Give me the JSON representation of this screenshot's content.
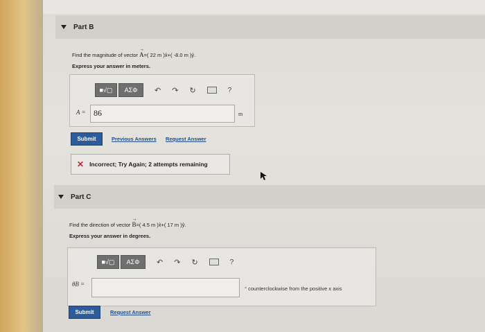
{
  "partB": {
    "title": "Part B",
    "question_prefix": "Find the magnitude of vector ",
    "vector": "A",
    "question_expr": "=( 22 m )x̂+( -8.0 m )ŷ.",
    "express": "Express your answer in meters.",
    "toolbar": {
      "math_btn": "■√▢",
      "greek_btn": "ΑΣΦ",
      "help": "?"
    },
    "field_label": "A =",
    "field_value": "86",
    "unit": "m",
    "submit": "Submit",
    "links": [
      "Previous Answers",
      "Request Answer"
    ],
    "feedback": "Incorrect; Try Again; 2 attempts remaining"
  },
  "partC": {
    "title": "Part C",
    "question_prefix": "Find the direction of vector ",
    "vector": "B",
    "question_expr": "=( 4.5 m )x̂+( 17 m )ŷ.",
    "express": "Express your answer in degrees.",
    "toolbar": {
      "math_btn": "■√▢",
      "greek_btn": "ΑΣΦ",
      "help": "?"
    },
    "field_label": "θB =",
    "field_value": "",
    "unit": "° counterclockwise from the positive x axis",
    "submit": "Submit",
    "links": [
      "Request Answer"
    ]
  }
}
